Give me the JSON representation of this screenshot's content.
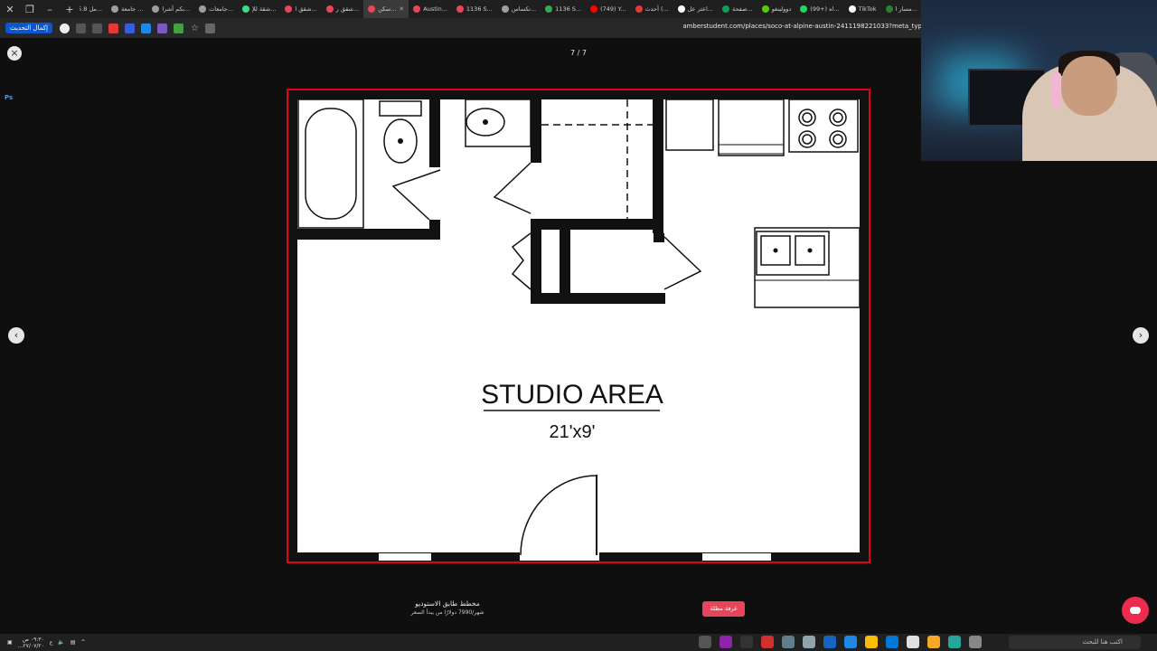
{
  "browser": {
    "tabs": [
      {
        "label": "مسار ا...",
        "color": "#2e7d32"
      },
      {
        "label": "TikTok",
        "color": "#ffffff"
      },
      {
        "label": "(99+) اه...",
        "color": "#25d366"
      },
      {
        "label": "دوولينغو",
        "color": "#58cc02"
      },
      {
        "label": "صفحة...",
        "color": "#0f9d58"
      },
      {
        "label": "اعثر عل...",
        "color": "#ffffff"
      },
      {
        "label": "أحدث (...",
        "color": "#e53935"
      },
      {
        "label": "(749) Y...",
        "color": "#ff0000"
      },
      {
        "label": "1136 S...",
        "color": "#34a853"
      },
      {
        "label": "تكساس...",
        "color": "#9e9e9e"
      },
      {
        "label": "1136 S...",
        "color": "#e8455a"
      },
      {
        "label": "Austin...",
        "color": "#e8455a"
      },
      {
        "label": "سكن...",
        "color": "#e8455a",
        "active": true
      },
      {
        "label": "شقق ر...",
        "color": "#e8455a"
      },
      {
        "label": "شقق ا...",
        "color": "#e8455a"
      },
      {
        "label": "شقة للإ...",
        "color": "#3ddc84"
      },
      {
        "label": "جامعات...",
        "color": "#9e9e9e"
      },
      {
        "label": "بكم أشرا...",
        "color": "#9e9e9e"
      },
      {
        "label": "جامعة ...",
        "color": "#9e9e9e"
      },
      {
        "label": "5.8 مل...",
        "color": "#9e9e9e"
      }
    ],
    "new_tab": "+",
    "update_label": "إكمال التحديث",
    "url": "amberstudent.com/places/soco-at-alpine-austin-2411198221033?meta_typ"
  },
  "lightbox": {
    "counter": "7 / 7",
    "close_icon": "×",
    "prev_icon": "‹",
    "next_icon": "›",
    "ps_label": "Ps"
  },
  "floorplan": {
    "title": "STUDIO AREA",
    "dimensions": "21'x9'",
    "border_color": "#e3001b"
  },
  "caption": {
    "title": "مخطط طابق الاستوديو",
    "subtitle": "شهر/7990 دولارًا من يبدأ السعر"
  },
  "cta": {
    "label": "غرفة مطلة"
  },
  "taskbar": {
    "time": "٠٩:٣٠ ص",
    "date": "٢٧/٠٧/٢٠...",
    "search_placeholder": "اكتب هنا للبحث"
  }
}
